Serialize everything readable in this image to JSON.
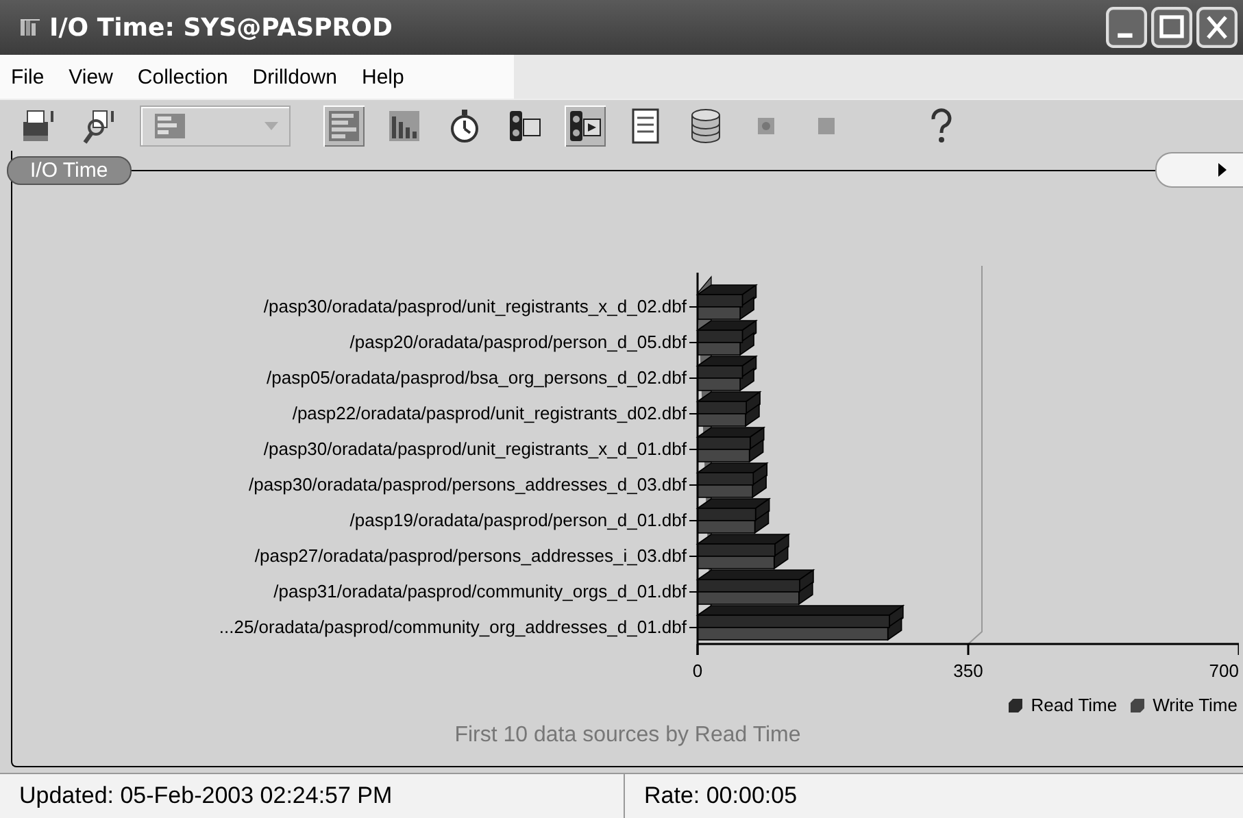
{
  "window": {
    "title": "I/O Time: SYS@PASPROD"
  },
  "menu": [
    {
      "label": "File"
    },
    {
      "label": "View"
    },
    {
      "label": "Collection"
    },
    {
      "label": "Drilldown"
    },
    {
      "label": "Help"
    }
  ],
  "toolbar": [
    {
      "kind": "print",
      "disabled": false
    },
    {
      "kind": "find",
      "disabled": false
    },
    {
      "kind": "dropdown",
      "disabled": true
    },
    {
      "kind": "bars",
      "selected": true
    },
    {
      "kind": "columns",
      "selected": false
    },
    {
      "kind": "timer",
      "disabled": false
    },
    {
      "kind": "light",
      "selected": false
    },
    {
      "kind": "light-play",
      "selected": true
    },
    {
      "kind": "report",
      "disabled": false
    },
    {
      "kind": "database",
      "disabled": false
    },
    {
      "kind": "record",
      "disabled": true
    },
    {
      "kind": "stop",
      "disabled": true
    },
    {
      "kind": "help",
      "disabled": false
    }
  ],
  "panel": {
    "tab": "I/O Time",
    "chart_data": {
      "type": "bar",
      "orientation": "horizontal",
      "categories": [
        "/pasp30/oradata/pasprod/unit_registrants_x_d_02.dbf",
        "/pasp20/oradata/pasprod/person_d_05.dbf",
        "/pasp05/oradata/pasprod/bsa_org_persons_d_02.dbf",
        "/pasp22/oradata/pasprod/unit_registrants_d02.dbf",
        "/pasp30/oradata/pasprod/unit_registrants_x_d_01.dbf",
        "/pasp30/oradata/pasprod/persons_addresses_d_03.dbf",
        "/pasp19/oradata/pasprod/person_d_01.dbf",
        "/pasp27/oradata/pasprod/persons_addresses_i_03.dbf",
        "/pasp31/oradata/pasprod/community_orgs_d_01.dbf",
        "...25/oradata/pasprod/community_org_addresses_d_01.dbf"
      ],
      "series": [
        {
          "name": "Read Time",
          "color": "#2a2a2a",
          "values": [
            58,
            58,
            58,
            63,
            68,
            72,
            75,
            100,
            132,
            248
          ]
        },
        {
          "name": "Write Time",
          "color": "#464646",
          "values": [
            55,
            55,
            55,
            62,
            67,
            71,
            74,
            99,
            131,
            246
          ]
        }
      ],
      "xlim": [
        0,
        700
      ],
      "xticks": [
        0,
        350,
        700
      ]
    },
    "caption": "First 10 data sources by Read Time"
  },
  "status_bar": [
    {
      "text": "Updated: 05-Feb-2003 02:24:57 PM"
    },
    {
      "text": "Rate: 00:00:05"
    }
  ]
}
